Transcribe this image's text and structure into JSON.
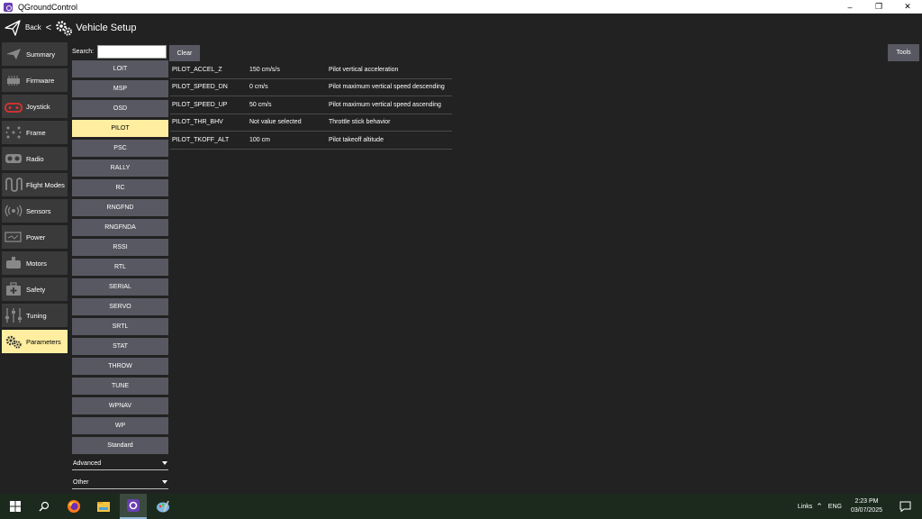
{
  "window": {
    "title": "QGroundControl",
    "controls": [
      "–",
      "❐",
      "✕"
    ]
  },
  "toolbar": {
    "back_label": "Back",
    "separator": "<",
    "title": "Vehicle Setup"
  },
  "sidebar": {
    "items": [
      {
        "label": "Summary",
        "icon": "summary-icon"
      },
      {
        "label": "Firmware",
        "icon": "firmware-icon"
      },
      {
        "label": "Joystick",
        "icon": "joystick-icon"
      },
      {
        "label": "Frame",
        "icon": "frame-icon"
      },
      {
        "label": "Radio",
        "icon": "radio-icon"
      },
      {
        "label": "Flight Modes",
        "icon": "flight-modes-icon"
      },
      {
        "label": "Sensors",
        "icon": "sensors-icon"
      },
      {
        "label": "Power",
        "icon": "power-icon"
      },
      {
        "label": "Motors",
        "icon": "motors-icon"
      },
      {
        "label": "Safety",
        "icon": "safety-icon"
      },
      {
        "label": "Tuning",
        "icon": "tuning-icon"
      },
      {
        "label": "Parameters",
        "icon": "parameters-icon",
        "active": true
      }
    ]
  },
  "search": {
    "label": "Search:",
    "value": "",
    "clear_label": "Clear"
  },
  "groups": {
    "items": [
      "LOIT",
      "MSP",
      "OSD",
      "PILOT",
      "PSC",
      "RALLY",
      "RC",
      "RNGFND",
      "RNGFNDA",
      "RSSI",
      "RTL",
      "SERIAL",
      "SERVO",
      "SRTL",
      "STAT",
      "THROW",
      "TUNE",
      "WPNAV",
      "WP",
      "Standard"
    ],
    "selected": "PILOT"
  },
  "dropdowns": {
    "advanced": "Advanced",
    "other": "Other"
  },
  "params": {
    "rows": [
      {
        "name": "PILOT_ACCEL_Z",
        "value": "150 cm/s/s",
        "desc": "Pilot vertical acceleration"
      },
      {
        "name": "PILOT_SPEED_DN",
        "value": "0 cm/s",
        "desc": "Pilot maximum vertical speed descending"
      },
      {
        "name": "PILOT_SPEED_UP",
        "value": "50 cm/s",
        "desc": "Pilot maximum vertical speed ascending"
      },
      {
        "name": "PILOT_THR_BHV",
        "value": "Not value selected",
        "desc": "Throttle stick behavior"
      },
      {
        "name": "PILOT_TKOFF_ALT",
        "value": "100 cm",
        "desc": "Pilot takeoff altitude"
      }
    ]
  },
  "tools_label": "Tools",
  "taskbar": {
    "links_label": "Links",
    "caret": "⌃",
    "lang": "ENG",
    "time": "2:23 PM",
    "date": "03/07/2025"
  },
  "colors": {
    "background": "#222222",
    "button": "#585862",
    "active": "#ffeea0",
    "nav_bg": "#3a3a3a",
    "taskbar": "#1c2a1e"
  }
}
